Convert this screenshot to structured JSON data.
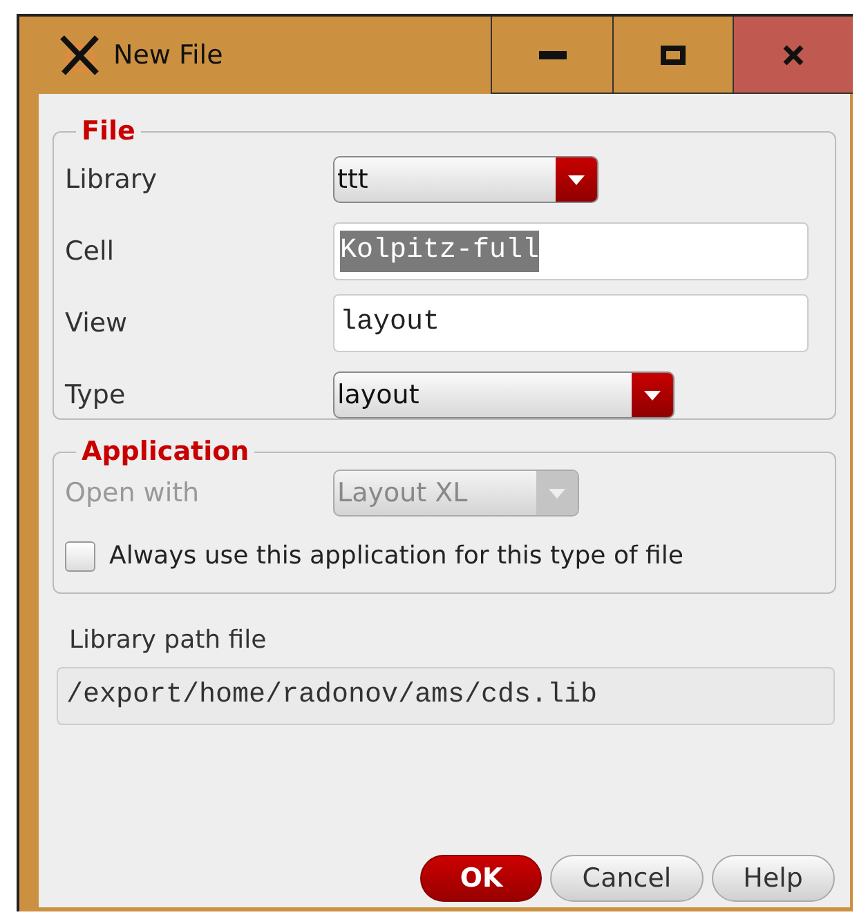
{
  "window": {
    "title": "New File",
    "controls": [
      {
        "kind": "minimize"
      },
      {
        "kind": "maximize"
      },
      {
        "kind": "close"
      }
    ]
  },
  "file_group": {
    "title": "File",
    "fields": [
      {
        "label": "Library",
        "kind": "dropdown",
        "value": "ttt",
        "disabled": false
      },
      {
        "label": "Cell",
        "kind": "text",
        "value": "Kolpitz-full",
        "highlighted": true
      },
      {
        "label": "View",
        "kind": "text",
        "value": "layout",
        "highlighted": false
      },
      {
        "label": "Type",
        "kind": "dropdown",
        "value": "layout",
        "disabled": false
      }
    ]
  },
  "application_group": {
    "title": "Application",
    "open_with": {
      "label": "Open with",
      "value": "Layout XL",
      "disabled": true
    },
    "always_use": {
      "label": "Always use this application for this type of file",
      "checked": false
    }
  },
  "library_path": {
    "label": "Library path file",
    "value": "/export/home/radonov/ams/cds.lib"
  },
  "buttons": [
    {
      "label": "OK",
      "default": true
    },
    {
      "label": "Cancel",
      "default": false
    },
    {
      "label": "Help",
      "default": false
    }
  ]
}
